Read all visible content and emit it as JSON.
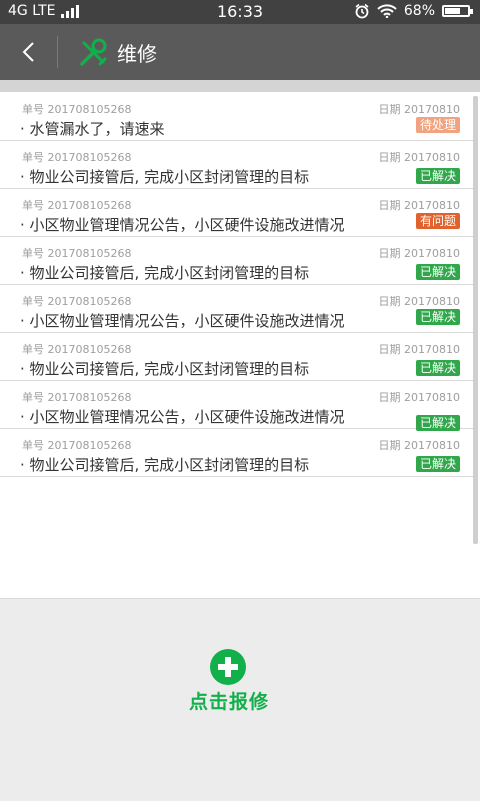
{
  "status": {
    "network": "4G LTE",
    "time": "16:33",
    "battery": "68%",
    "battery_level": 0.68
  },
  "header": {
    "title": "维修"
  },
  "list": {
    "number_label": "单号",
    "date_label": "日期",
    "items": [
      {
        "number": "201708105268",
        "date": "20170810",
        "text": "· 水管漏水了，请速来",
        "status": "待处理",
        "status_color": "#f0a37e"
      },
      {
        "number": "201708105268",
        "date": "20170810",
        "text": "· 物业公司接管后, 完成小区封闭管理的目标",
        "status": "已解决",
        "status_color": "#2fa74a"
      },
      {
        "number": "201708105268",
        "date": "20170810",
        "text": "· 小区物业管理情况公告，小区硬件设施改进情况",
        "status": "有问题",
        "status_color": "#e0622c"
      },
      {
        "number": "201708105268",
        "date": "20170810",
        "text": "· 物业公司接管后, 完成小区封闭管理的目标",
        "status": "已解决",
        "status_color": "#2fa74a"
      },
      {
        "number": "201708105268",
        "date": "20170810",
        "text": "· 小区物业管理情况公告，小区硬件设施改进情况",
        "status": "已解决",
        "status_color": "#2fa74a"
      },
      {
        "number": "201708105268",
        "date": "20170810",
        "text": "· 物业公司接管后, 完成小区封闭管理的目标",
        "status": "已解决",
        "status_color": "#2fa74a"
      },
      {
        "number": "201708105268",
        "date": "20170810",
        "text": "· 小区物业管理情况公告，小区硬件设施改进情况",
        "status": "已解决",
        "status_color": "#2fa74a"
      },
      {
        "number": "201708105268",
        "date": "20170810",
        "text": "· 物业公司接管后, 完成小区封闭管理的目标",
        "status": "已解决",
        "status_color": "#2fa74a"
      }
    ]
  },
  "action": {
    "label": "点击报修",
    "color": "#12b04a"
  }
}
